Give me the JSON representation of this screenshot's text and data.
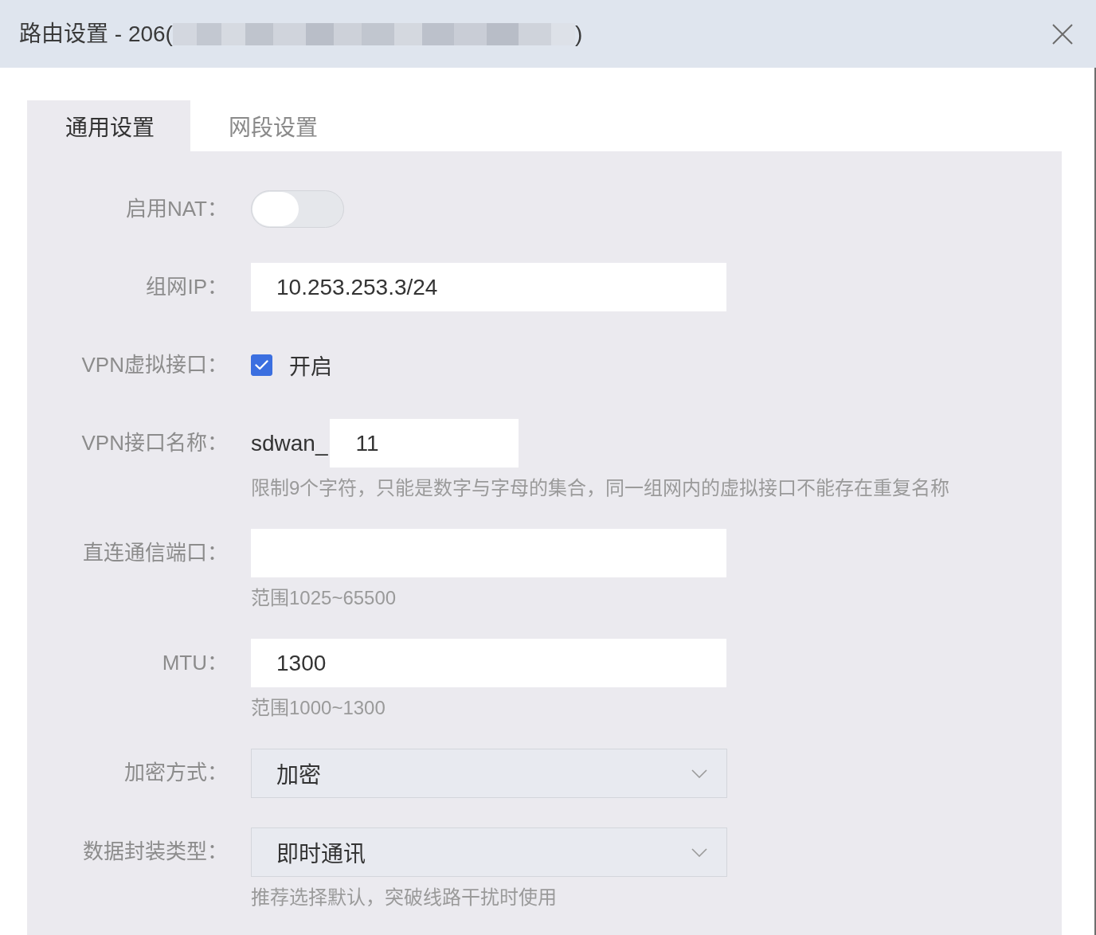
{
  "dialog": {
    "title": "路由设置 - 206(",
    "title_end": ")",
    "redacted": true
  },
  "tabs": [
    {
      "label": "通用设置",
      "selected": true
    },
    {
      "label": "网段设置",
      "selected": false
    }
  ],
  "fields": [
    {
      "kind": "switch",
      "label": "启用NAT：",
      "on": false
    },
    {
      "kind": "text",
      "label": "组网IP：",
      "value": "10.253.253.3/24"
    },
    {
      "kind": "checkbox",
      "label": "VPN虚拟接口：",
      "checked": true,
      "option": "开启"
    },
    {
      "kind": "prefixed",
      "label": "VPN接口名称：",
      "prefix": "sdwan_",
      "value": "11",
      "hint": "限制9个字符，只能是数字与字母的集合，同一组网内的虚拟接口不能存在重复名称"
    },
    {
      "kind": "text",
      "label": "直连通信端口：",
      "hint": "范围1025~65500"
    },
    {
      "kind": "text",
      "label": "MTU：",
      "value": "1300",
      "hint": "范围1000~1300"
    },
    {
      "kind": "select",
      "label": "加密方式：",
      "value": "加密"
    },
    {
      "kind": "select",
      "label": "数据封装类型：",
      "value": "即时通讯",
      "hint": "推荐选择默认，突破线路干扰时使用"
    }
  ]
}
